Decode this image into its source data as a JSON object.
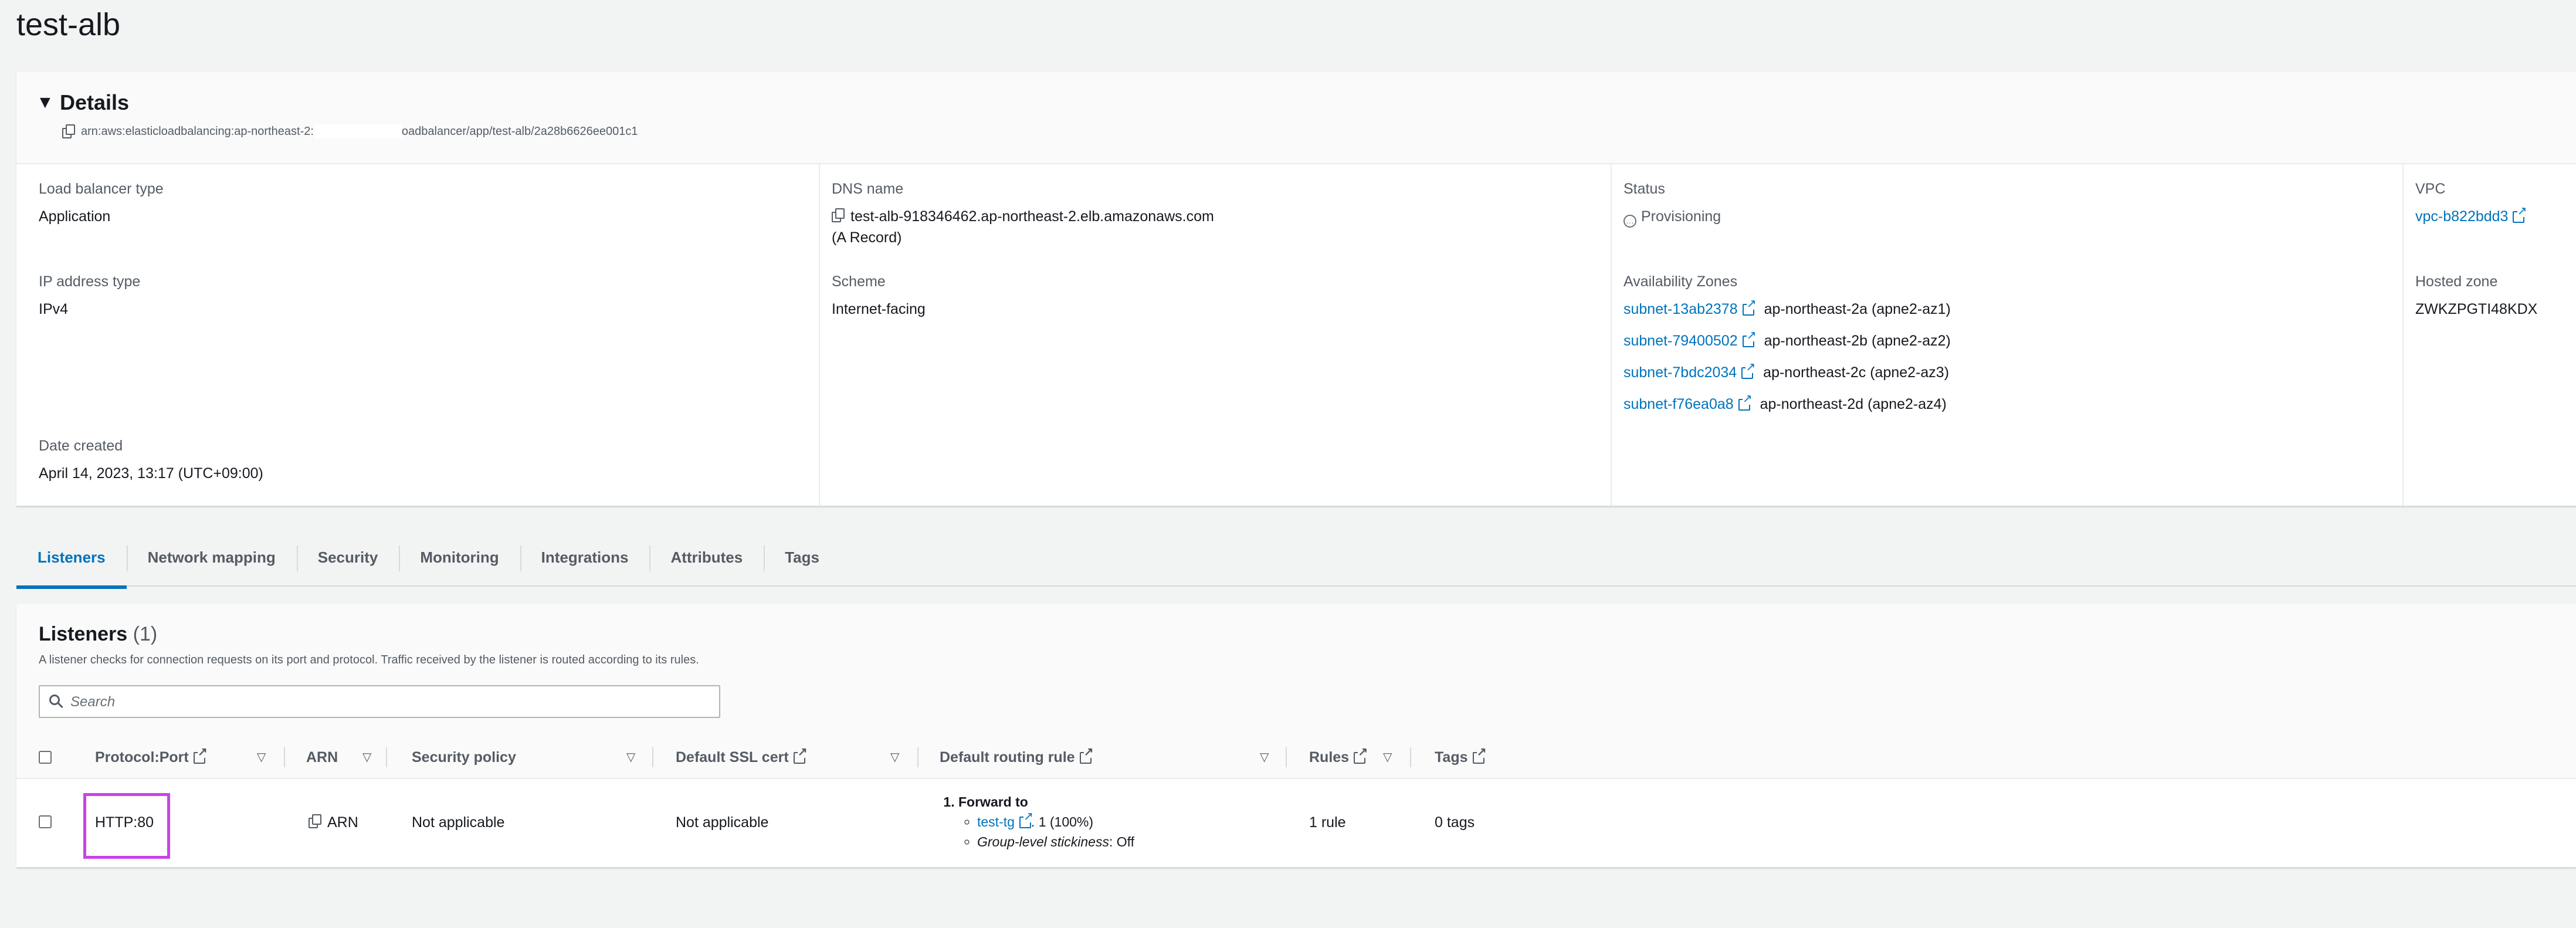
{
  "page": {
    "title": "test-alb"
  },
  "details": {
    "heading": "Details",
    "arn_prefix": "arn:aws:elasticloadbalancing:ap-northeast-2:",
    "arn_suffix": "oadbalancer/app/test-alb/2a28b6626ee001c1",
    "load_balancer_type": {
      "label": "Load balancer type",
      "value": "Application"
    },
    "ip_address_type": {
      "label": "IP address type",
      "value": "IPv4"
    },
    "date_created": {
      "label": "Date created",
      "value": "April 14, 2023, 13:17 (UTC+09:00)"
    },
    "dns_name": {
      "label": "DNS name",
      "value": "test-alb-918346462.ap-northeast-2.elb.amazonaws.com",
      "record": "(A Record)"
    },
    "scheme": {
      "label": "Scheme",
      "value": "Internet-facing"
    },
    "status": {
      "label": "Status",
      "value": "Provisioning"
    },
    "availability_zones": {
      "label": "Availability Zones",
      "items": [
        {
          "subnet": "subnet-13ab2378",
          "zone": "ap-northeast-2a (apne2-az1)"
        },
        {
          "subnet": "subnet-79400502",
          "zone": "ap-northeast-2b (apne2-az2)"
        },
        {
          "subnet": "subnet-7bdc2034",
          "zone": "ap-northeast-2c (apne2-az3)"
        },
        {
          "subnet": "subnet-f76ea0a8",
          "zone": "ap-northeast-2d (apne2-az4)"
        }
      ]
    },
    "vpc": {
      "label": "VPC",
      "value": "vpc-b822bdd3"
    },
    "hosted_zone": {
      "label": "Hosted zone",
      "value": "ZWKZPGTI48KDX"
    }
  },
  "tabs": [
    "Listeners",
    "Network mapping",
    "Security",
    "Monitoring",
    "Integrations",
    "Attributes",
    "Tags"
  ],
  "listeners": {
    "title": "Listeners",
    "count": "(1)",
    "description": "A listener checks for connection requests on its port and protocol. Traffic received by the listener is routed according to its rules.",
    "search_placeholder": "Search",
    "columns": {
      "protocol_port": "Protocol:Port",
      "arn": "ARN",
      "security_policy": "Security policy",
      "ssl_cert": "Default SSL cert",
      "routing_rule": "Default routing rule",
      "rules": "Rules",
      "tags": "Tags"
    },
    "row": {
      "protocol_port": "HTTP:80",
      "arn": "ARN",
      "security_policy": "Not applicable",
      "ssl_cert": "Not applicable",
      "routing_step": "Forward to",
      "target_group": "test-tg",
      "target_weight": ": 1 (100%)",
      "stickiness_label": "Group-level stickiness",
      "stickiness_value": ": Off",
      "rules": "1 rule",
      "tags": "0 tags"
    }
  },
  "colors": {
    "link": "#0073bb",
    "highlight": "#c942e8"
  }
}
